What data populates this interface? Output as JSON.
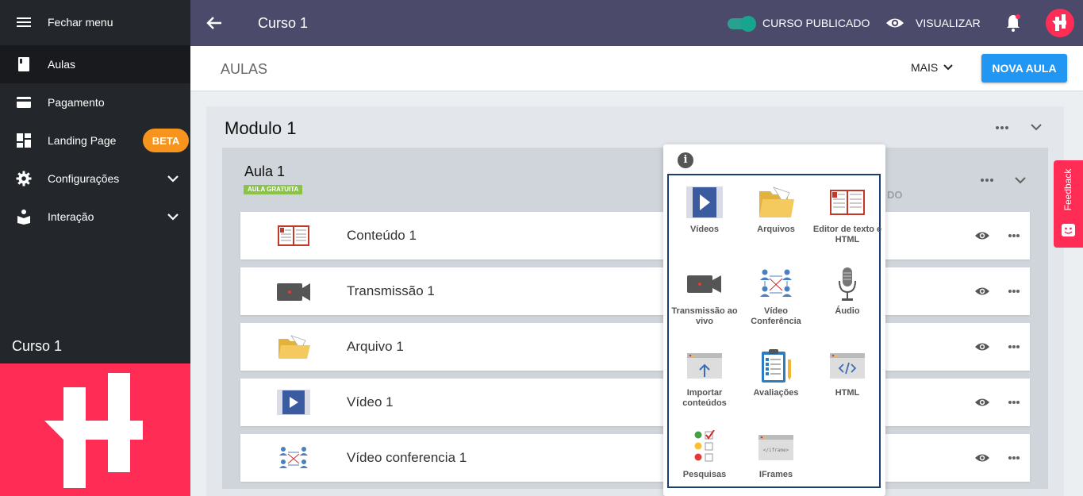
{
  "sidebar": {
    "close_menu": "Fechar menu",
    "items": [
      {
        "label": "Aulas"
      },
      {
        "label": "Pagamento"
      },
      {
        "label": "Landing Page",
        "badge": "BETA"
      },
      {
        "label": "Configurações"
      },
      {
        "label": "Interação"
      }
    ],
    "course_name": "Curso 1"
  },
  "topbar": {
    "title": "Curso 1",
    "published_label": "CURSO PUBLICADO",
    "view_label": "VISUALIZAR"
  },
  "header": {
    "title": "AULAS",
    "more_label": "MAIS",
    "new_lesson_label": "NOVA AULA"
  },
  "module": {
    "title": "Modulo 1",
    "lesson": {
      "title": "Aula 1",
      "badge": "AULA GRATUITA",
      "partial_text": "DO",
      "items": [
        {
          "label": "Conteúdo 1",
          "icon": "text-editor-icon"
        },
        {
          "label": "Transmissão 1",
          "icon": "video-camera-icon"
        },
        {
          "label": "Arquivo 1",
          "icon": "folder-icon"
        },
        {
          "label": "Vídeo 1",
          "icon": "video-play-icon"
        },
        {
          "label": "Vídeo conferencia 1",
          "icon": "video-conference-icon"
        }
      ]
    }
  },
  "popup": {
    "info": "i",
    "options": [
      {
        "label": "Vídeos",
        "icon": "video-play-icon"
      },
      {
        "label": "Arquivos",
        "icon": "folder-icon"
      },
      {
        "label": "Editor de texto e HTML",
        "icon": "text-editor-icon"
      },
      {
        "label": "Transmissão ao vivo",
        "icon": "video-camera-icon"
      },
      {
        "label": "Vídeo Conferência",
        "icon": "video-conference-icon"
      },
      {
        "label": "Áudio",
        "icon": "microphone-icon"
      },
      {
        "label": "Importar conteúdos",
        "icon": "import-icon"
      },
      {
        "label": "Avaliações",
        "icon": "clipboard-icon"
      },
      {
        "label": "HTML",
        "icon": "html-code-icon"
      },
      {
        "label": "Pesquisas",
        "icon": "survey-icon"
      },
      {
        "label": "IFrames",
        "icon": "iframe-icon"
      }
    ]
  },
  "feedback": {
    "label": "Feedback"
  },
  "colors": {
    "brand": "#ff2d55",
    "topbar": "#4b4a6b",
    "accent": "#2196f3",
    "toggle": "#18a58f",
    "badge": "#f7941d"
  }
}
